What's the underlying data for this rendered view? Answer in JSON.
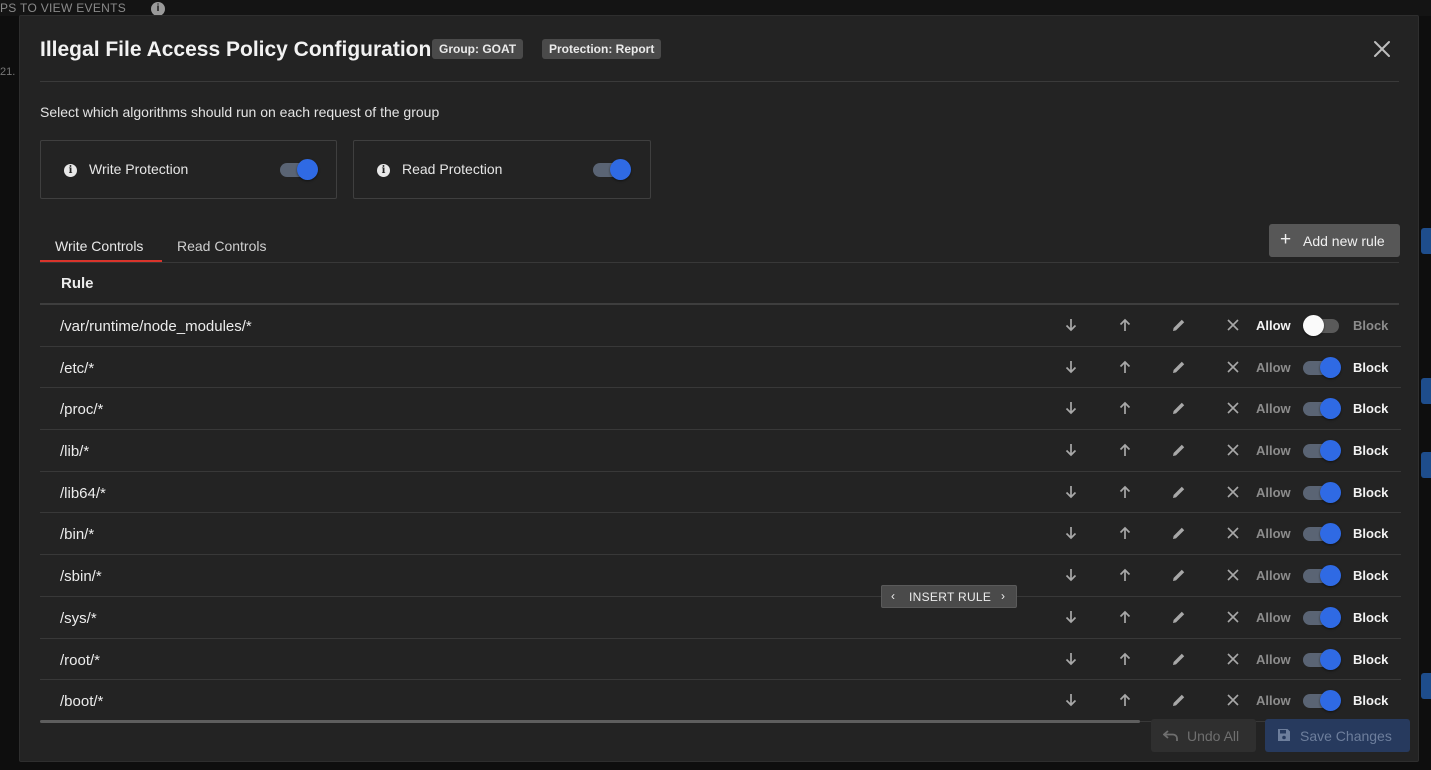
{
  "background": {
    "strip_text": "PS TO VIEW EVENTS",
    "info_glyph": "i",
    "left_fragment": "21."
  },
  "modal": {
    "title": "Illegal File Access Policy Configuration",
    "badges": {
      "group": "Group: GOAT",
      "protection": "Protection: Report"
    },
    "subtitle": "Select which algorithms should run on each request of the group",
    "algorithms": [
      {
        "label": "Write Protection",
        "enabled": true,
        "icon": "info-icon"
      },
      {
        "label": "Read Protection",
        "enabled": true,
        "icon": "info-icon"
      }
    ],
    "tabs": [
      {
        "label": "Write Controls",
        "active": true
      },
      {
        "label": "Read Controls",
        "active": false
      }
    ],
    "add_rule_label": "Add new rule",
    "table": {
      "column_header": "Rule",
      "allow_label": "Allow",
      "block_label": "Block",
      "row_actions": [
        "move-down-icon",
        "move-up-icon",
        "edit-pencil-icon",
        "delete-x-icon"
      ],
      "rows": [
        {
          "path": "/var/runtime/node_modules/*",
          "mode": "Allow"
        },
        {
          "path": "/etc/*",
          "mode": "Block"
        },
        {
          "path": "/proc/*",
          "mode": "Block"
        },
        {
          "path": "/lib/*",
          "mode": "Block"
        },
        {
          "path": "/lib64/*",
          "mode": "Block"
        },
        {
          "path": "/bin/*",
          "mode": "Block"
        },
        {
          "path": "/sbin/*",
          "mode": "Block"
        },
        {
          "path": "/sys/*",
          "mode": "Block"
        },
        {
          "path": "/root/*",
          "mode": "Block"
        },
        {
          "path": "/boot/*",
          "mode": "Block"
        }
      ]
    },
    "insert_rule": {
      "label": "INSERT RULE",
      "prev": "‹",
      "next": "›"
    },
    "footer": {
      "undo_label": "Undo All",
      "save_label": "Save Changes"
    }
  },
  "colors": {
    "accent_blue": "#2f6ae4",
    "tab_underline_red": "#d9342b",
    "modal_bg": "#232323"
  }
}
